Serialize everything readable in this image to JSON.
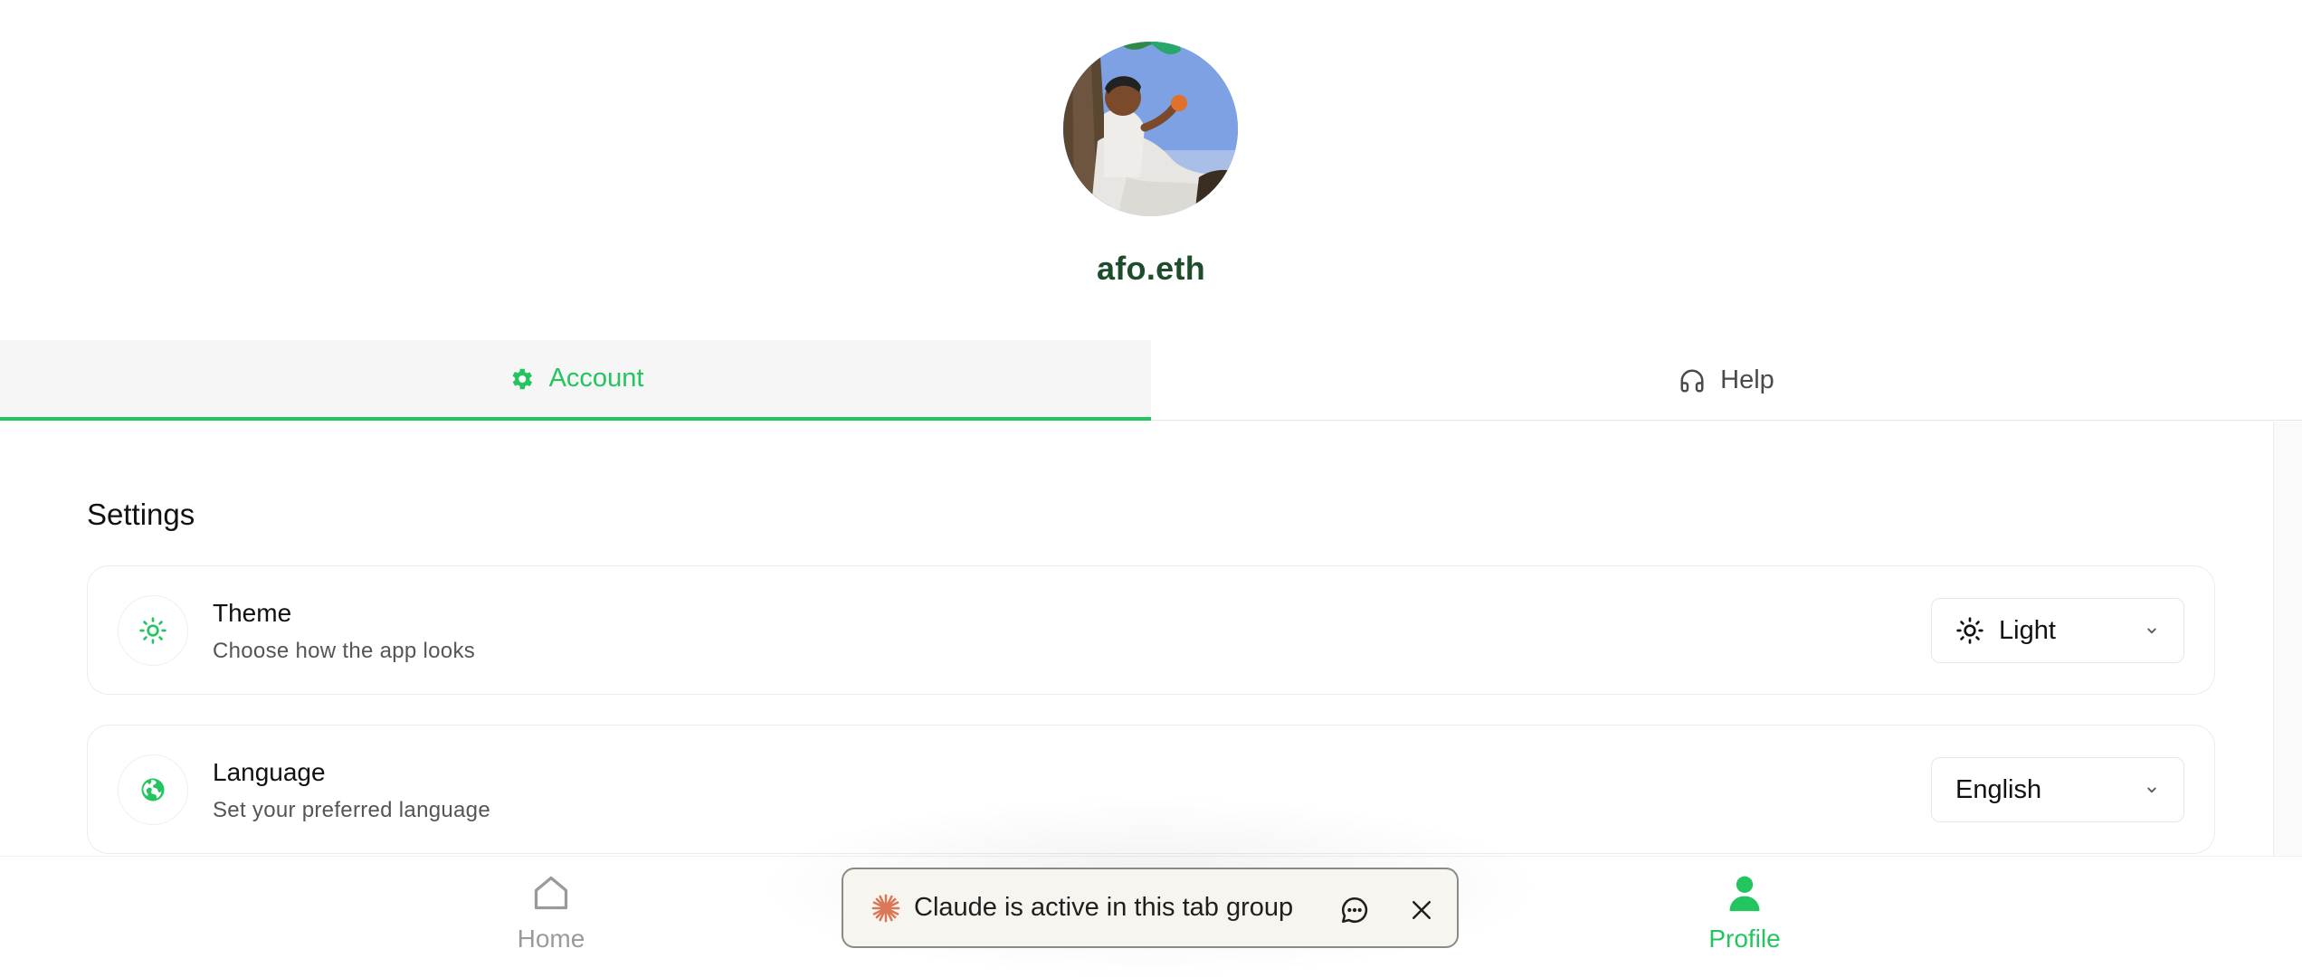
{
  "profile": {
    "username": "afo.eth"
  },
  "tabs": [
    {
      "label": "Account",
      "icon": "gear-icon",
      "active": true
    },
    {
      "label": "Help",
      "icon": "headphones-icon",
      "active": false
    }
  ],
  "settings": {
    "title": "Settings",
    "items": [
      {
        "title": "Theme",
        "subtitle": "Choose how the app looks",
        "icon": "sun-icon",
        "selected_value": "Light",
        "selected_icon": "sun-icon"
      },
      {
        "title": "Language",
        "subtitle": "Set your preferred language",
        "icon": "globe-icon",
        "selected_value": "English"
      }
    ]
  },
  "bottom_nav": {
    "items": [
      {
        "label": "Home",
        "icon": "home-icon",
        "active": false
      },
      {
        "label": "Profile",
        "icon": "user-icon",
        "active": true
      }
    ]
  },
  "claude_banner": {
    "text": "Claude is active in this tab group",
    "icon": "claude-spark-icon"
  },
  "colors": {
    "accent": "#22c55e",
    "username": "#1d4d2b",
    "inactive_nav": "#9a9a9a",
    "banner_bg": "#f7f5f0",
    "claude_orange": "#d97757"
  }
}
